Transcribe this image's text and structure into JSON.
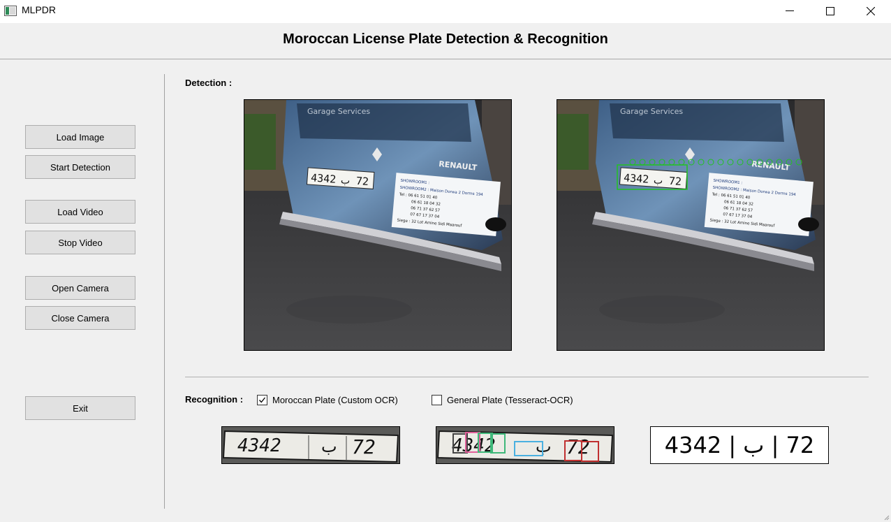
{
  "window": {
    "title": "MLPDR"
  },
  "header": {
    "title": "Moroccan License Plate Detection & Recognition"
  },
  "sidebar": {
    "buttons": {
      "load_image": "Load Image",
      "start_detection": "Start Detection",
      "load_video": "Load Video",
      "stop_video": "Stop Video",
      "open_camera": "Open Camera",
      "close_camera": "Close Camera",
      "exit": "Exit"
    }
  },
  "detection": {
    "label": "Detection :",
    "van_brand": "RENAULT",
    "plate_number": "4342",
    "plate_letter": "ب",
    "plate_region": "72",
    "ad_lines": [
      "SHOWROOM1 :",
      "SHOWROOM2 : Maison Dorwa 2 Dorms 194",
      "Tel : 06 61 51 01 40",
      "06 61 18 04 32",
      "06 71 37 62 57",
      "07 67 17 37 04",
      "Siege : 32 Lot Amine Sidi Maarouf"
    ]
  },
  "recognition": {
    "label": "Recognition :",
    "options": [
      {
        "label": "Moroccan Plate (Custom OCR)",
        "checked": true
      },
      {
        "label": "General Plate (Tesseract-OCR)",
        "checked": false
      }
    ],
    "result_text": "4342 | ب | 72"
  },
  "colors": {
    "window_bg": "#f0f0f0",
    "button_bg": "#e1e1e1",
    "detection_box": "#22c222",
    "char_box_pink": "#e0609a",
    "char_box_green": "#3fb87a",
    "char_box_blue": "#4ab0e0",
    "char_box_red": "#c03030"
  },
  "icons": {
    "app": "app-icon",
    "minimize": "minimize-icon",
    "maximize": "maximize-icon",
    "close": "close-icon",
    "check": "checkmark-icon"
  }
}
